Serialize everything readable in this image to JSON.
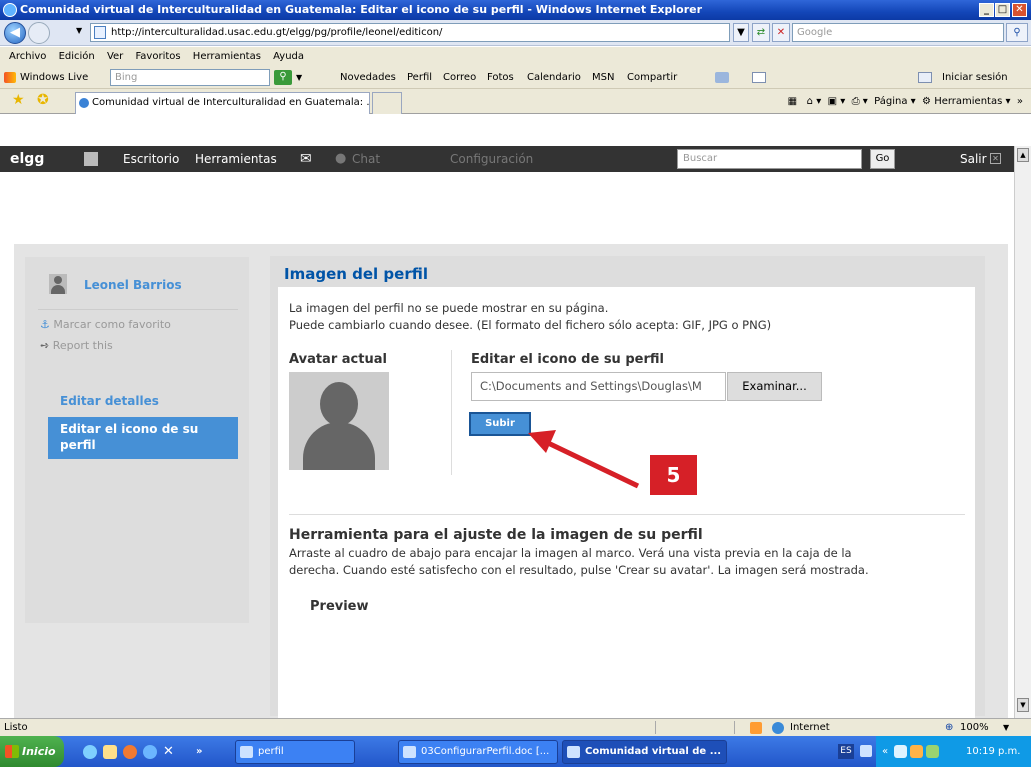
{
  "window": {
    "title": "Comunidad virtual de Interculturalidad en Guatemala: Editar el icono de su perfil - Windows Internet Explorer",
    "min": "_",
    "max": "□",
    "close": "✕"
  },
  "address": {
    "url": "http://interculturalidad.usac.edu.gt/elgg/pg/profile/leonel/editicon/",
    "search_placeholder": "Google"
  },
  "menu": [
    "Archivo",
    "Edición",
    "Ver",
    "Favoritos",
    "Herramientas",
    "Ayuda"
  ],
  "windowslive": {
    "label": "Windows Live",
    "search_placeholder": "Bing",
    "links": [
      "Novedades",
      "Perfil",
      "Correo",
      "Fotos",
      "Calendario",
      "MSN",
      "Compartir"
    ],
    "signin": "Iniciar sesión"
  },
  "tabs": {
    "active": "Comunidad virtual de Interculturalidad en Guatemala: ...",
    "page_menu": "Página",
    "tools_menu": "Herramientas"
  },
  "elgg": {
    "logo": "elgg",
    "nav": [
      "Escritorio",
      "Herramientas",
      "Chat",
      "Configuración"
    ],
    "search_placeholder": "Buscar",
    "go": "Go",
    "logout": "Salir"
  },
  "site_title": "Comunidad virtual de Interculturalidad en Guatemala",
  "sidebar": {
    "owner": "Leonel Barrios",
    "favorite": "Marcar como favorito",
    "report": "Report this",
    "edit_details": "Editar detalles",
    "edit_icon": "Editar el icono de su perfil"
  },
  "main": {
    "heading": "Imagen del perfil",
    "line1": "La imagen del perfil no se puede mostrar en su página.",
    "line2": "Puede cambiarlo cuando desee. (El formato del fichero sólo acepta: GIF, JPG o PNG)",
    "current_avatar": "Avatar actual",
    "edit_icon_heading": "Editar el icono de su perfil",
    "file_value": "C:\\Documents and Settings\\Douglas\\M",
    "browse": "Examinar...",
    "upload": "Subir",
    "tool_heading": "Herramienta para el ajuste de la imagen de su perfil",
    "tool_line1": "Arraste al cuadro de abajo para encajar la imagen al marco. Verá una vista previa en la caja de la",
    "tool_line2": "derecha. Cuando esté satisfecho con el resultado, pulse 'Crear su avatar'. La imagen será mostrada.",
    "preview": "Preview"
  },
  "annotation": {
    "step": "5",
    "color": "#d62027"
  },
  "status": {
    "left": "Listo",
    "zone": "Internet",
    "zoom": "100%"
  },
  "taskbar": {
    "start": "Inicio",
    "more": "»",
    "folder": "perfil",
    "doc": "03ConfigurarPerfil.doc [...",
    "ie": "Comunidad virtual de ...",
    "lang": "ES",
    "tray_more": "«",
    "time": "10:19 p.m."
  }
}
